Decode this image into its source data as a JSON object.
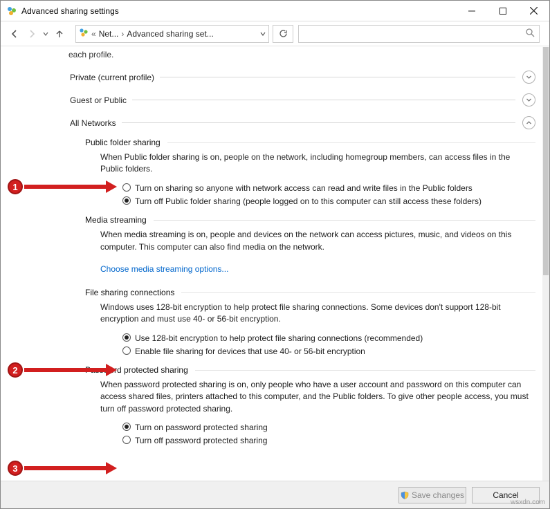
{
  "window": {
    "title": "Advanced sharing settings"
  },
  "nav": {
    "crumb1": "Net...",
    "crumb2": "Advanced sharing set...",
    "search_placeholder": ""
  },
  "content": {
    "each_profile": "each profile.",
    "profiles": {
      "private": "Private (current profile)",
      "guest": "Guest or Public",
      "all": "All Networks"
    },
    "public_folder": {
      "heading": "Public folder sharing",
      "desc": "When Public folder sharing is on, people on the network, including homegroup members, can access files in the Public folders.",
      "opt_on": "Turn on sharing so anyone with network access can read and write files in the Public folders",
      "opt_off": "Turn off Public folder sharing (people logged on to this computer can still access these folders)"
    },
    "media": {
      "heading": "Media streaming",
      "desc": "When media streaming is on, people and devices on the network can access pictures, music, and videos on this computer. This computer can also find media on the network.",
      "link": "Choose media streaming options..."
    },
    "filesharing": {
      "heading": "File sharing connections",
      "desc": "Windows uses 128-bit encryption to help protect file sharing connections. Some devices don't support 128-bit encryption and must use 40- or 56-bit encryption.",
      "opt_128": "Use 128-bit encryption to help protect file sharing connections (recommended)",
      "opt_4056": "Enable file sharing for devices that use 40- or 56-bit encryption"
    },
    "password": {
      "heading": "Password protected sharing",
      "desc": "When password protected sharing is on, only people who have a user account and password on this computer can access shared files, printers attached to this computer, and the Public folders. To give other people access, you must turn off password protected sharing.",
      "opt_on": "Turn on password protected sharing",
      "opt_off": "Turn off password protected sharing"
    }
  },
  "footer": {
    "save": "Save changes",
    "cancel": "Cancel"
  },
  "annotations": {
    "b1": "1",
    "b2": "2",
    "b3": "3"
  },
  "watermark": "wsxdn.com"
}
